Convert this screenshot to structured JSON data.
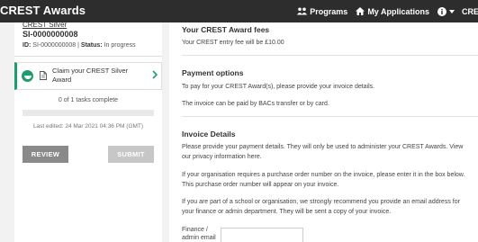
{
  "app": {
    "brand": "CREST Awards"
  },
  "nav": {
    "programs": "Programs",
    "applications": "My Applications",
    "crest": "CREST"
  },
  "sidebar": {
    "award_link": "CREST Silver",
    "award_id": "SI-0000000008",
    "id_label": "ID:",
    "id_value": "SI-0000000008",
    "status_label": "Status:",
    "status_value": "In progress",
    "task": {
      "label": "Claim your CREST Silver Award"
    },
    "tasks_complete": "0 of 1 tasks complete",
    "progress_fraction": 0,
    "last_edited": "Last edited: 24 Mar 2021 04:36 PM (GMT)",
    "review_label": "REVIEW",
    "submit_label": "SUBMIT"
  },
  "main": {
    "fees_heading": "Your CREST Award fees",
    "fees_text": "Your CREST entry fee will be £10.00",
    "payment_heading": "Payment options",
    "payment_text1": "To pay for your CREST Award(s), please provide your invoice details.",
    "payment_text2": "The invoice can be paid by BACs transfer or by card.",
    "invoice_heading": "Invoice Details",
    "invoice_text1": "Please provide your payment details. They will only be used to administer your CREST Awards. View our privacy information here.",
    "invoice_text2": "If your organisation requires a purchase order number on the invoice, please enter it in the box below. This purchase order number will appear on your invoice.",
    "invoice_text3": "If you are part of a school or organisation, we strongly recommend you provide an email address for your finance or admin department. They will be sent a copy of your invoice.",
    "finance_label": "Finance / admin email"
  },
  "colors": {
    "accent": "#1b9e6c",
    "topbar": "#2d2d2d"
  }
}
